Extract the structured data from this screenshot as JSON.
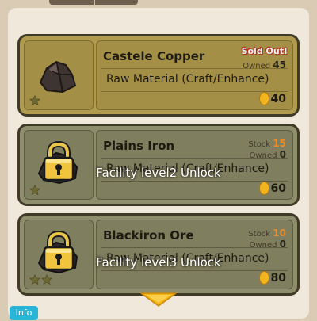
{
  "items": [
    {
      "name": "Castele Copper",
      "category": "Raw Material (Craft/Enhance)",
      "status": "Sold Out!",
      "owned_label": "Owned",
      "owned": "45",
      "price": "40",
      "stars": 1,
      "locked": false
    },
    {
      "name": "Plains Iron",
      "category": "Raw Material (Craft/Enhance)",
      "stock_label": "Stock",
      "stock": "15",
      "owned_label": "Owned",
      "owned": "0",
      "price": "60",
      "stars": 1,
      "locked": true,
      "lock_message": "Facility level2 Unlock"
    },
    {
      "name": "Blackiron Ore",
      "category": "Raw Material (Craft/Enhance)",
      "stock_label": "Stock",
      "stock": "10",
      "owned_label": "Owned",
      "owned": "0",
      "price": "80",
      "stars": 2,
      "locked": true,
      "lock_message": "Facility level3 Unlock"
    }
  ],
  "info_button": "Info",
  "icons": {
    "ore": "ore-rock-icon",
    "lock": "padlock-icon",
    "star": "star-icon",
    "coin": "coin-icon",
    "scroll": "chevron-down-icon"
  },
  "colors": {
    "sold_out": "#b0311c",
    "stock_highlight": "#f08a23",
    "info_button": "#29b6d6",
    "scroll_arrow": "#f5b514"
  }
}
